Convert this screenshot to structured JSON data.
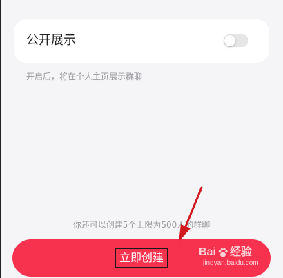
{
  "settings_card": {
    "label": "公开展示",
    "toggle_on": false
  },
  "hint": "开启后，将在个人主页展示群聊",
  "quota_text": "你还可以创建5个上限为500人的群聊",
  "create_button": {
    "label": "立即创建",
    "color": "#f6324e"
  },
  "watermark": {
    "logo_text_left": "Bai",
    "logo_text_right": "经验",
    "url": "jingyan.baidu.com"
  },
  "colors": {
    "background": "#f5f5f7",
    "card": "#ffffff",
    "annotation": "#d01a1f"
  }
}
